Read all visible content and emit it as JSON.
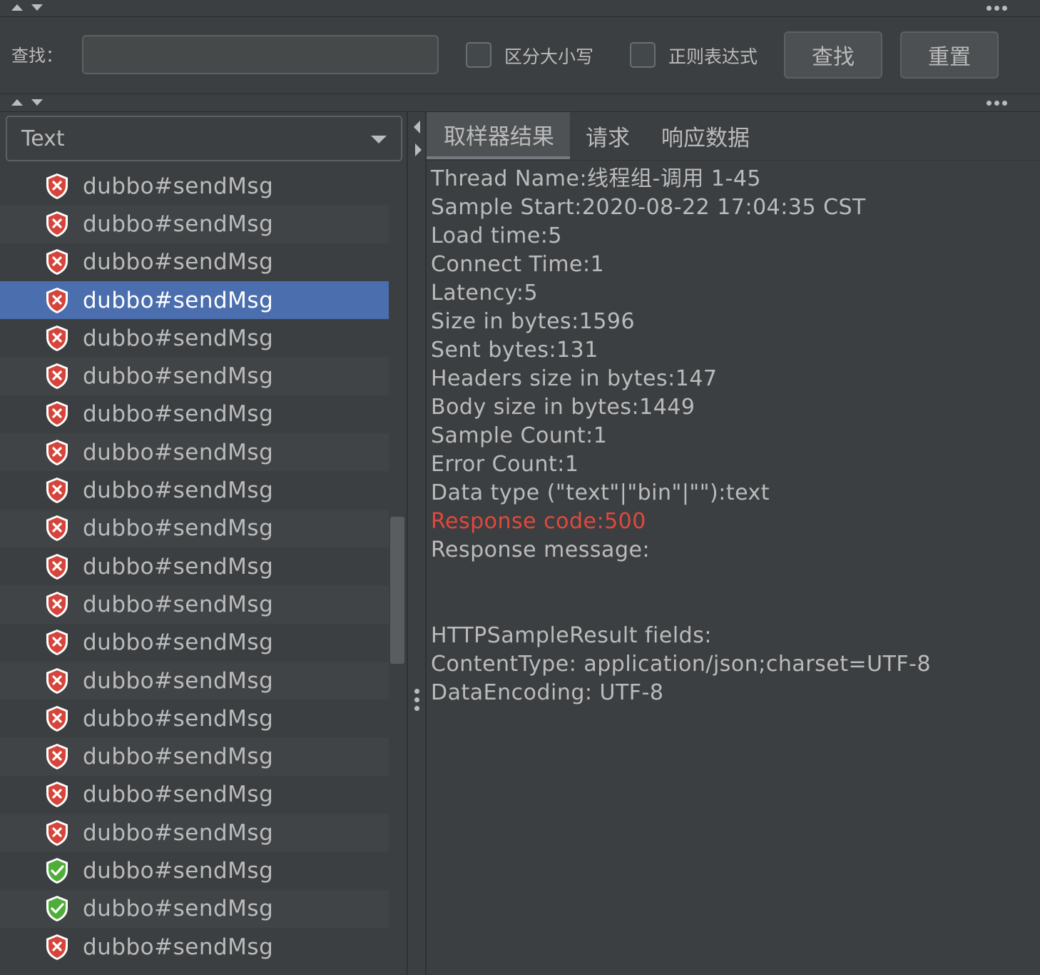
{
  "search": {
    "label": "查找：",
    "value": "",
    "placeholder": "",
    "case_sensitive_label": "区分大小写",
    "regex_label": "正则表达式",
    "find_button": "查找",
    "reset_button": "重置"
  },
  "renderer": {
    "selected": "Text"
  },
  "samples": [
    {
      "label": "dubbo#sendMsg",
      "status": "error"
    },
    {
      "label": "dubbo#sendMsg",
      "status": "error"
    },
    {
      "label": "dubbo#sendMsg",
      "status": "error"
    },
    {
      "label": "dubbo#sendMsg",
      "status": "error",
      "selected": true
    },
    {
      "label": "dubbo#sendMsg",
      "status": "error"
    },
    {
      "label": "dubbo#sendMsg",
      "status": "error"
    },
    {
      "label": "dubbo#sendMsg",
      "status": "error"
    },
    {
      "label": "dubbo#sendMsg",
      "status": "error"
    },
    {
      "label": "dubbo#sendMsg",
      "status": "error"
    },
    {
      "label": "dubbo#sendMsg",
      "status": "error"
    },
    {
      "label": "dubbo#sendMsg",
      "status": "error"
    },
    {
      "label": "dubbo#sendMsg",
      "status": "error"
    },
    {
      "label": "dubbo#sendMsg",
      "status": "error"
    },
    {
      "label": "dubbo#sendMsg",
      "status": "error"
    },
    {
      "label": "dubbo#sendMsg",
      "status": "error"
    },
    {
      "label": "dubbo#sendMsg",
      "status": "error"
    },
    {
      "label": "dubbo#sendMsg",
      "status": "error"
    },
    {
      "label": "dubbo#sendMsg",
      "status": "error"
    },
    {
      "label": "dubbo#sendMsg",
      "status": "success"
    },
    {
      "label": "dubbo#sendMsg",
      "status": "success"
    },
    {
      "label": "dubbo#sendMsg",
      "status": "error"
    }
  ],
  "tabs": [
    {
      "label": "取样器结果",
      "active": true
    },
    {
      "label": "请求",
      "active": false
    },
    {
      "label": "响应数据",
      "active": false
    }
  ],
  "result_lines": [
    {
      "text": "Thread Name:线程组-调用 1-45"
    },
    {
      "text": "Sample Start:2020-08-22 17:04:35 CST"
    },
    {
      "text": "Load time:5"
    },
    {
      "text": "Connect Time:1"
    },
    {
      "text": "Latency:5"
    },
    {
      "text": "Size in bytes:1596"
    },
    {
      "text": "Sent bytes:131"
    },
    {
      "text": "Headers size in bytes:147"
    },
    {
      "text": "Body size in bytes:1449"
    },
    {
      "text": "Sample Count:1"
    },
    {
      "text": "Error Count:1"
    },
    {
      "text": "Data type (\"text\"|\"bin\"|\"\"):text"
    },
    {
      "text": "Response code:500",
      "error": true
    },
    {
      "text": "Response message:"
    },
    {
      "text": ""
    },
    {
      "text": ""
    },
    {
      "text": "HTTPSampleResult fields:"
    },
    {
      "text": "ContentType: application/json;charset=UTF-8"
    },
    {
      "text": "DataEncoding: UTF-8"
    }
  ],
  "colors": {
    "background": "#3c3f41",
    "selection": "#4b6eaf",
    "error_text": "#e0483d",
    "error_icon": "#d6453b",
    "success_icon": "#4fae3a"
  },
  "icons": {
    "error": "shield-error-icon",
    "success": "shield-success-icon"
  }
}
